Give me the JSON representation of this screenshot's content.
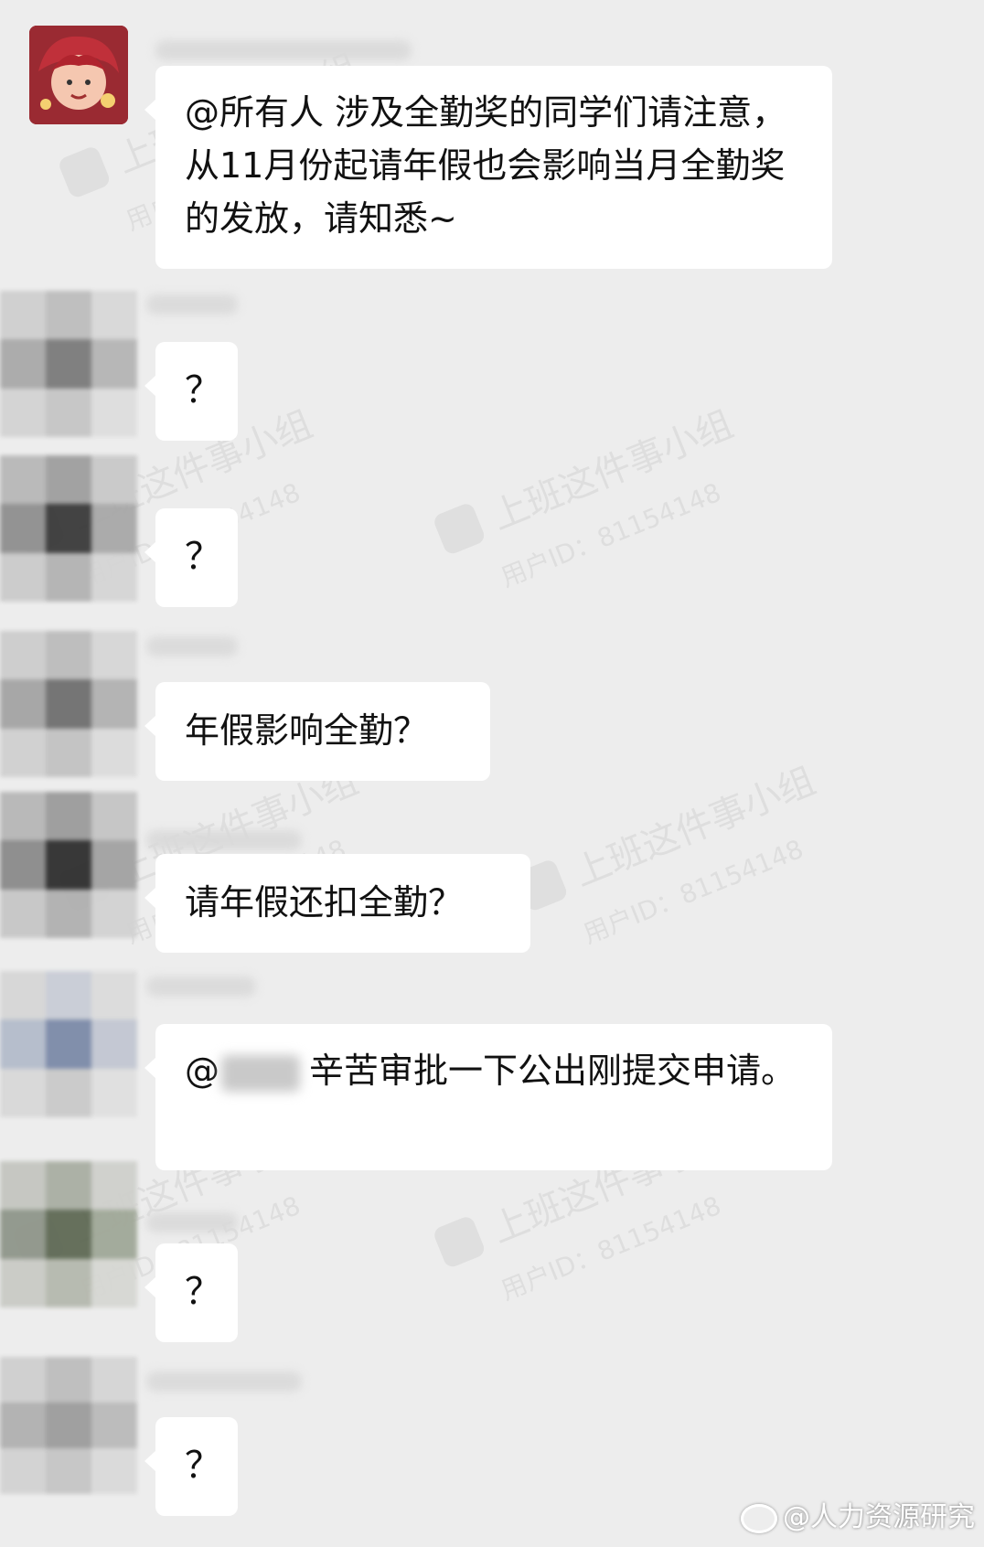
{
  "messages": [
    {
      "text_prefix": "",
      "text": "@所有人  涉及全勤奖的同学们请注意，从11月份起请年假也会影响当月全勤奖的发放，请知悉~"
    },
    {
      "text_prefix": "",
      "text": "？"
    },
    {
      "text_prefix": "",
      "text": "？"
    },
    {
      "text_prefix": "",
      "text": "年假影响全勤？"
    },
    {
      "text_prefix": "",
      "text": "请年假还扣全勤？"
    },
    {
      "text_prefix": "@",
      "text": "辛苦审批一下公出刚提交申请。"
    },
    {
      "text_prefix": "",
      "text": "？"
    },
    {
      "text_prefix": "",
      "text": "？"
    }
  ],
  "watermark": {
    "line1": "上班这件事小组",
    "line2": "用户ID：81154148",
    "logo": "豆"
  },
  "footer": {
    "weibo_icon": "weibo-logo-icon",
    "credit": "@人力资源研究"
  },
  "colors": {
    "background": "#ededed",
    "bubble": "#ffffff",
    "avatar_red": "#9a2a32"
  }
}
